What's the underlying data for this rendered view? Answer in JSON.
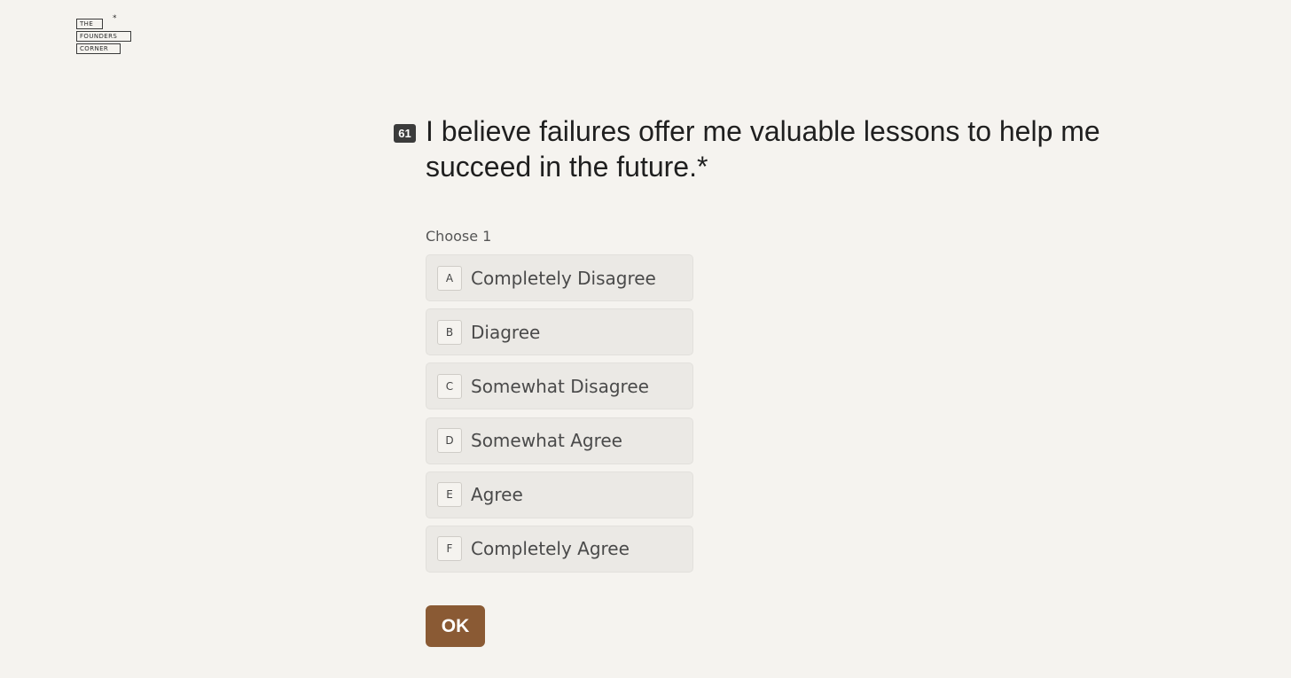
{
  "logo": {
    "line1": "THE",
    "line2": "FOUNDERS",
    "line3": "CORNER",
    "mark": "*"
  },
  "question": {
    "number": "61",
    "text": "I believe failures offer me valuable lessons to help me succeed in the future.",
    "required_marker": "*"
  },
  "choose_label": "Choose 1",
  "options": [
    {
      "key": "A",
      "label": "Completely Disagree"
    },
    {
      "key": "B",
      "label": "Diagree"
    },
    {
      "key": "C",
      "label": "Somewhat Disagree"
    },
    {
      "key": "D",
      "label": "Somewhat Agree"
    },
    {
      "key": "E",
      "label": "Agree"
    },
    {
      "key": "F",
      "label": "Completely Agree"
    }
  ],
  "ok_label": "OK",
  "colors": {
    "background": "#f5f3ef",
    "option_bg": "#ebe9e5",
    "accent": "#8a5a34",
    "badge": "#3b3b3b"
  }
}
